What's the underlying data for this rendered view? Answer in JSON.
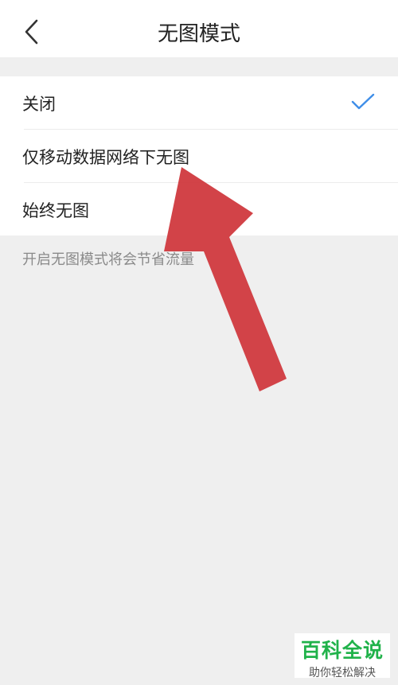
{
  "header": {
    "title": "无图模式",
    "back_icon": "chevron-left-icon"
  },
  "options": [
    {
      "label": "关闭",
      "selected": true
    },
    {
      "label": "仅移动数据网络下无图",
      "selected": false
    },
    {
      "label": "始终无图",
      "selected": false
    }
  ],
  "hint": "开启无图模式将会节省流量",
  "colors": {
    "accent": "#3f8ee8",
    "arrow": "#d0393e",
    "background": "#efefef",
    "watermark_green": "#20b24a"
  },
  "watermark": {
    "main": "百科全说",
    "sub": "助你轻松解决"
  }
}
